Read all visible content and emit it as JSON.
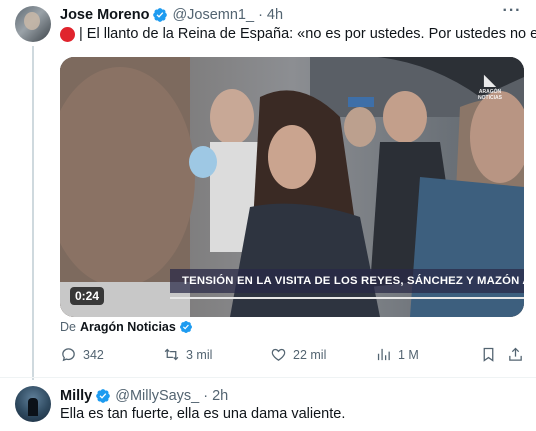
{
  "tweet": {
    "author_name": "Jose Moreno",
    "handle": "@Josemn1_",
    "separator": "·",
    "time": "4h",
    "text": "| El llanto de la Reina de España: «no es por ustedes. Por ustedes no es».",
    "media": {
      "banner": "TENSIÓN EN LA VISITA DE LOS REYES, SÁNCHEZ Y MAZÓN A PAIPORTA",
      "duration": "0:24",
      "watermark": "ARAGÓN NOTICIAS"
    },
    "source_prefix": "De",
    "source_name": "Aragón Noticias",
    "actions": {
      "replies": "342",
      "reposts": "3 mil",
      "likes": "22 mil",
      "views": "1 M"
    }
  },
  "reply": {
    "author_name": "Milly",
    "handle": "@MillySays_",
    "separator": "·",
    "time": "2h",
    "text": "Ella es tan fuerte, ella es una dama valiente."
  },
  "colors": {
    "verified": "#1d9bf0",
    "text": "#0f1419",
    "muted": "#536471",
    "red_dot": "#e0242d"
  }
}
